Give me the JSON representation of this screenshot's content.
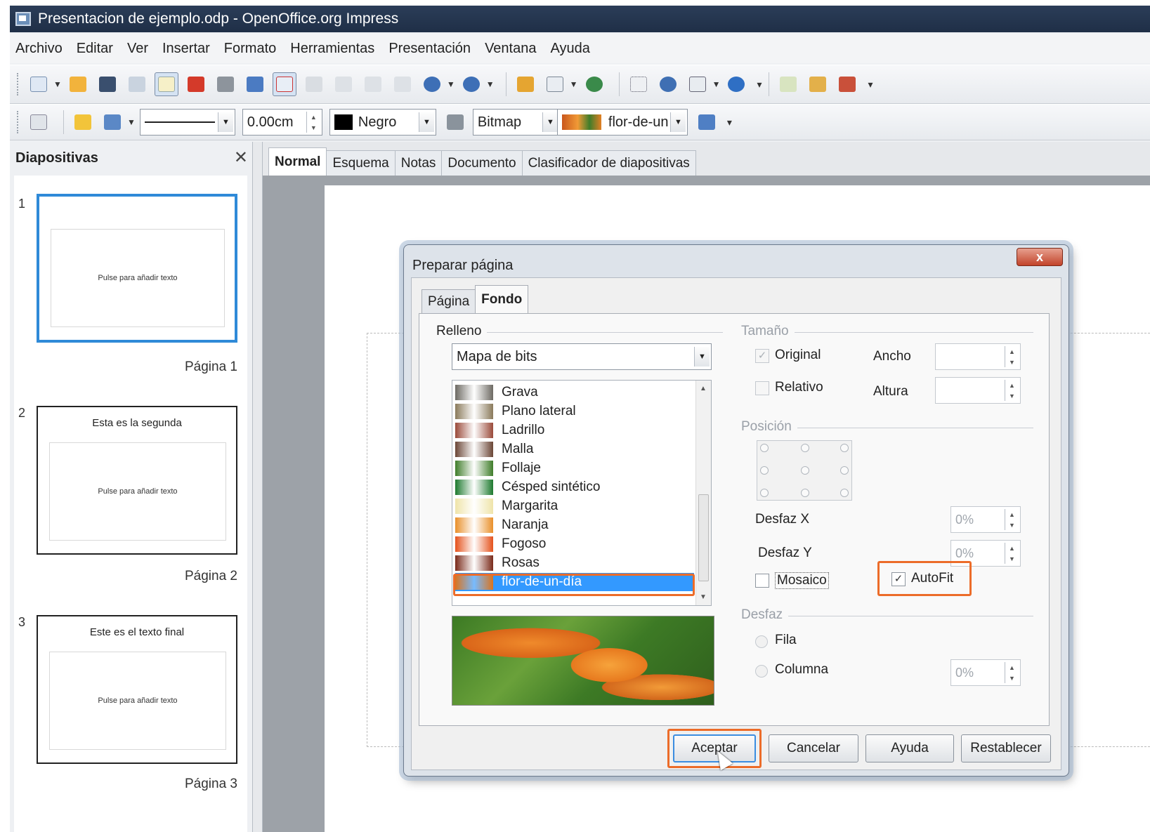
{
  "window": {
    "title": "Presentacion de ejemplo.odp - OpenOffice.org Impress"
  },
  "menu": [
    "Archivo",
    "Editar",
    "Ver",
    "Insertar",
    "Formato",
    "Herramientas",
    "Presentación",
    "Ventana",
    "Ayuda"
  ],
  "toolbar2": {
    "line_width": "0.00cm",
    "color": "Negro",
    "area_style": "Bitmap",
    "bitmap": "flor-de-un"
  },
  "slides_pane": {
    "title": "Diapositivas",
    "close": "✕",
    "slides": [
      {
        "number": "1",
        "heading": "",
        "body": "Pulse para añadir texto",
        "page_label": "Página 1"
      },
      {
        "number": "2",
        "heading": "Esta es la segunda",
        "body": "Pulse para añadir texto",
        "page_label": "Página 2"
      },
      {
        "number": "3",
        "heading": "Este es el texto final",
        "body": "Pulse para añadir texto",
        "page_label": "Página 3"
      }
    ]
  },
  "view_tabs": [
    "Normal",
    "Esquema",
    "Notas",
    "Documento",
    "Clasificador de diapositivas"
  ],
  "dialog": {
    "title": "Preparar página",
    "close": "x",
    "tabs": [
      "Página",
      "Fondo"
    ],
    "fill_group": "Relleno",
    "fill_type": "Mapa de bits",
    "bitmaps": [
      {
        "name": "Grava",
        "color": "#6d6a63"
      },
      {
        "name": "Plano lateral",
        "color": "#8a7a5b"
      },
      {
        "name": "Ladrillo",
        "color": "#9a4a3a"
      },
      {
        "name": "Malla",
        "color": "#6b4636"
      },
      {
        "name": "Follaje",
        "color": "#3f7d2a"
      },
      {
        "name": "Césped sintético",
        "color": "#1e7a2f"
      },
      {
        "name": "Margarita",
        "color": "#efe4a9"
      },
      {
        "name": "Naranja",
        "color": "#e9902a"
      },
      {
        "name": "Fogoso",
        "color": "#e5521c"
      },
      {
        "name": "Rosas",
        "color": "#7a2a1a"
      },
      {
        "name": "flor-de-un-día",
        "color": "#d9741f"
      }
    ],
    "size_group": "Tamaño",
    "original": "Original",
    "relative": "Relativo",
    "width": "Ancho",
    "height": "Altura",
    "position_group": "Posición",
    "offset_x": "Desfaz X",
    "offset_x_value": "0%",
    "offset_y": "Desfaz Y",
    "offset_y_value": "0%",
    "tile": "Mosaico",
    "autofit": "AutoFit",
    "offset_group": "Desfaz",
    "row": "Fila",
    "column": "Columna",
    "column_value": "0%",
    "buttons": {
      "ok": "Aceptar",
      "cancel": "Cancelar",
      "help": "Ayuda",
      "reset": "Restablecer"
    }
  },
  "colors": {
    "highlight": "#ec6c29",
    "selection": "#3399ff",
    "title_bar": "#1f2f47"
  }
}
